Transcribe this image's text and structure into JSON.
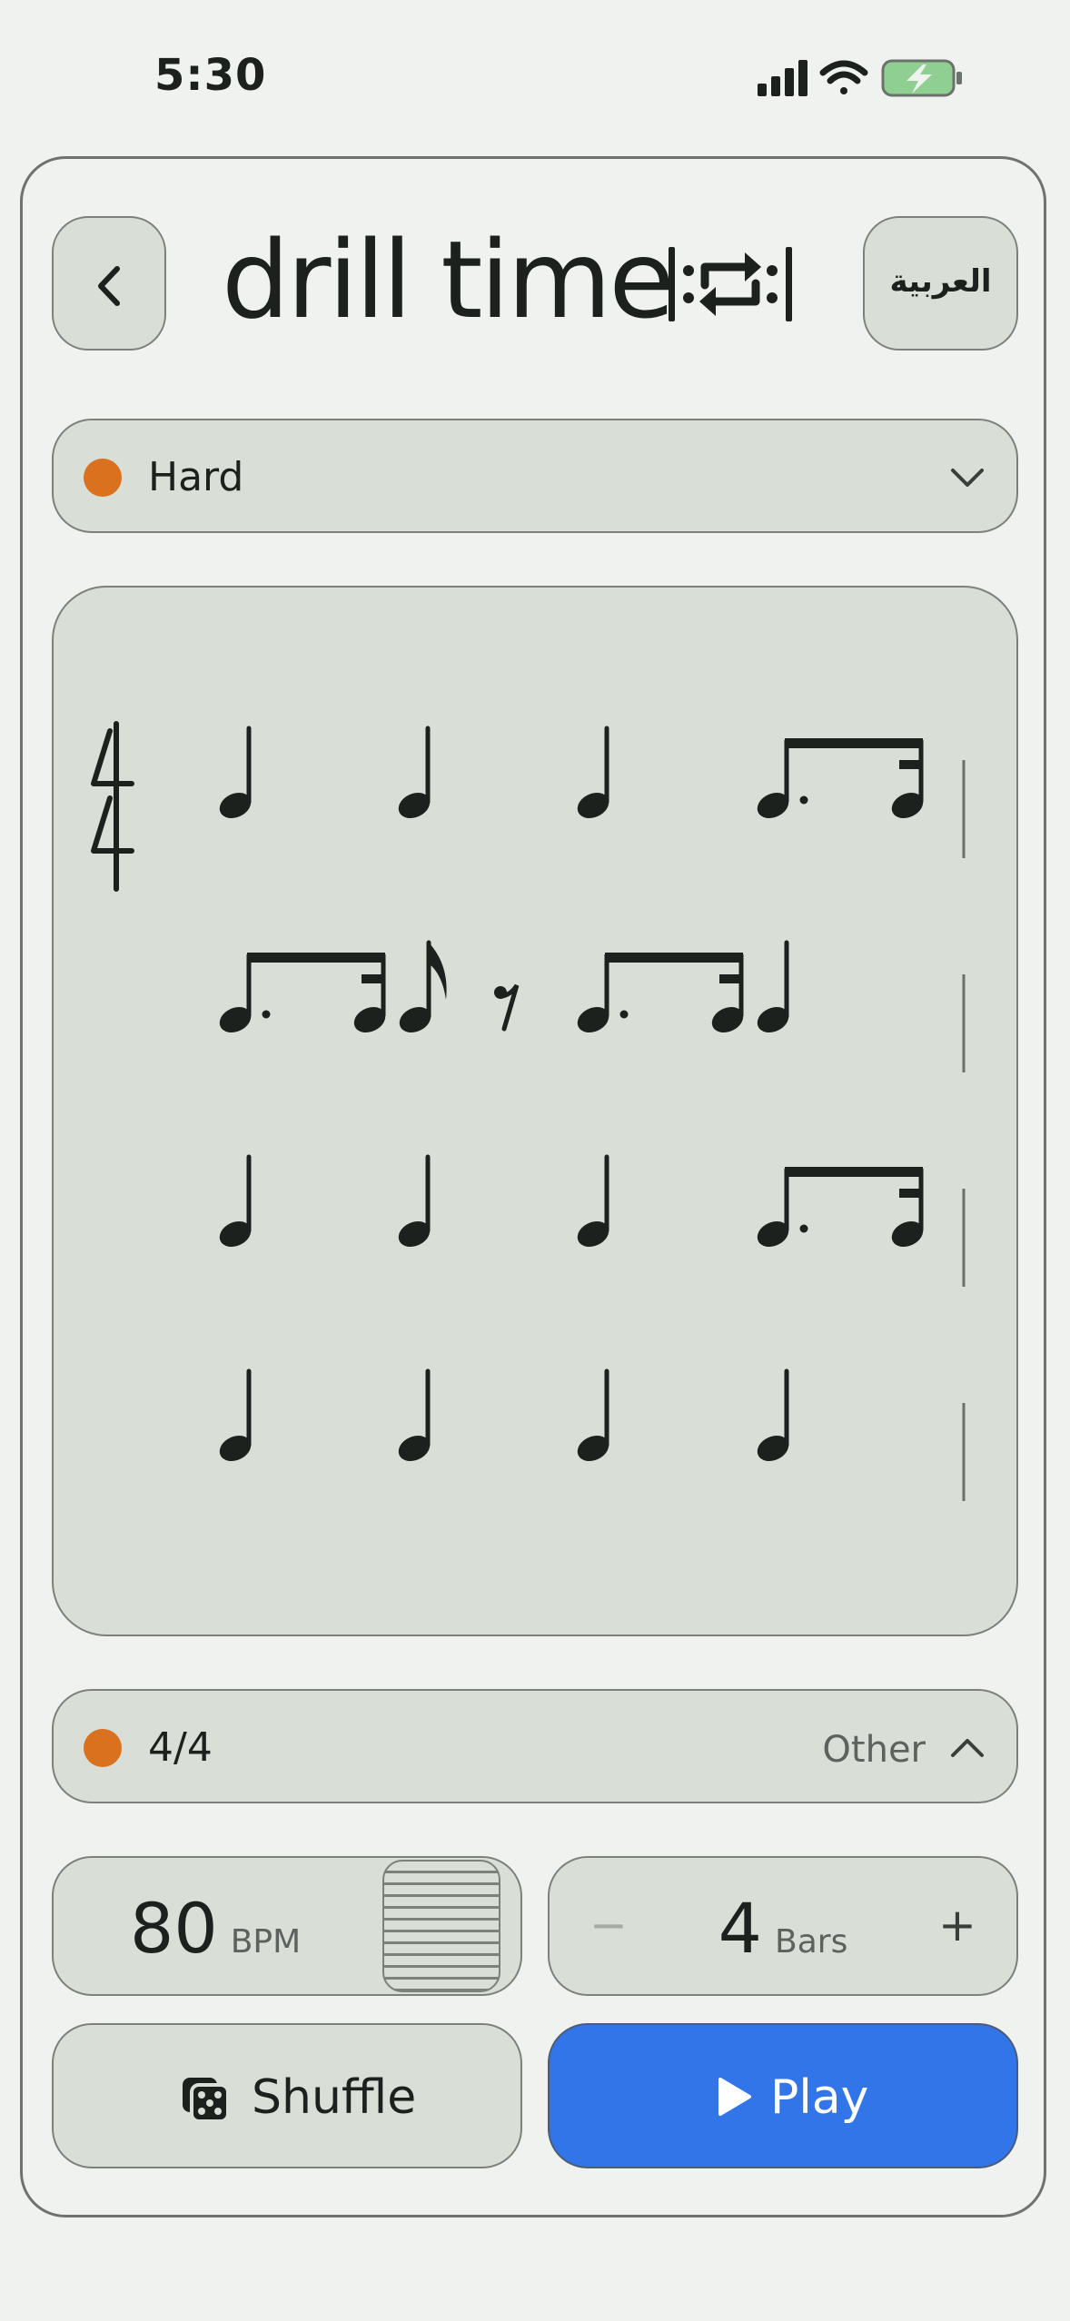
{
  "status_bar": {
    "time": "5:30"
  },
  "header": {
    "title": "drill time",
    "language_button": "العربية",
    "back_icon": "chevron-left-icon",
    "logo_icon": "repeat-icon"
  },
  "difficulty": {
    "label": "Hard",
    "dot_color": "#d9711e",
    "chevron_icon": "chevron-down-icon"
  },
  "notation": {
    "time_signature": {
      "top": "4",
      "bottom": "4"
    },
    "bars": [
      [
        "quarter",
        "quarter",
        "quarter",
        "dotted-eighth + sixteenth"
      ],
      [
        "dotted-eighth + sixteenth",
        "eighth",
        "eighth-rest",
        "dotted-eighth + sixteenth",
        "quarter"
      ],
      [
        "quarter",
        "quarter",
        "quarter",
        "dotted-eighth + sixteenth"
      ],
      [
        "quarter",
        "quarter",
        "quarter",
        "quarter"
      ]
    ]
  },
  "meter": {
    "label": "4/4",
    "dot_color": "#d9711e",
    "other_label": "Other",
    "chevron_icon": "chevron-up-icon"
  },
  "tempo": {
    "value": "80",
    "unit": "BPM"
  },
  "bars_count": {
    "value": "4",
    "unit": "Bars",
    "minus": "−",
    "plus": "+"
  },
  "actions": {
    "shuffle_label": "Shuffle",
    "play_label": "Play",
    "shuffle_icon": "dice-icon",
    "play_icon": "play-icon",
    "play_color": "#3175e8"
  }
}
